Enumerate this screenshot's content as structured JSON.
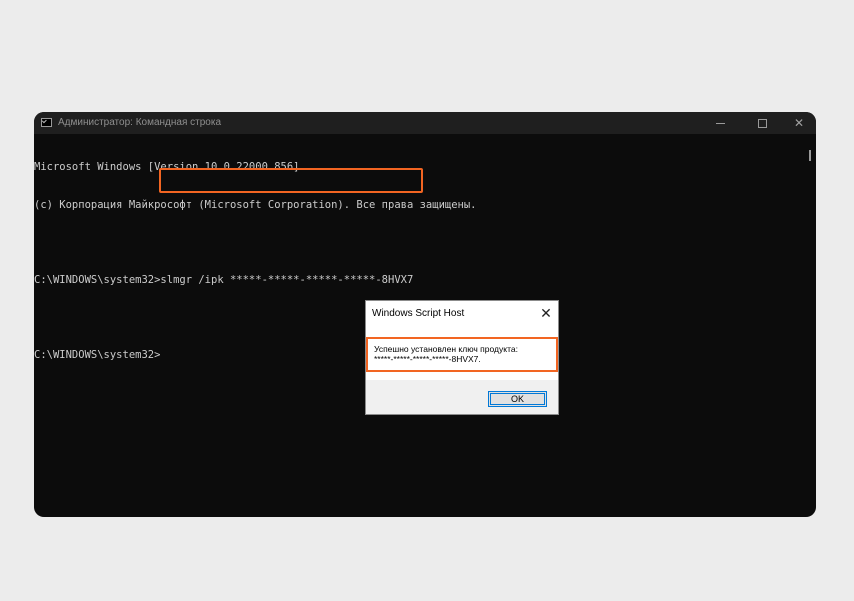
{
  "window": {
    "title": "Администратор: Командная строка",
    "icon": "cmd-icon"
  },
  "console": {
    "lines": [
      "Microsoft Windows [Version 10.0.22000.856]",
      "(c) Корпорация Майкрософт (Microsoft Corporation). Все права защищены.",
      "",
      "C:\\WINDOWS\\system32>slmgr /ipk *****-*****-*****-*****-8HVX7",
      "",
      "C:\\WINDOWS\\system32>"
    ],
    "highlight_color": "#f26522"
  },
  "dialog": {
    "title": "Windows Script Host",
    "message_line1": "Успешно установлен ключ продукта:",
    "message_line2": "*****-*****-*****-*****-8HVX7.",
    "ok_label": "OK"
  }
}
